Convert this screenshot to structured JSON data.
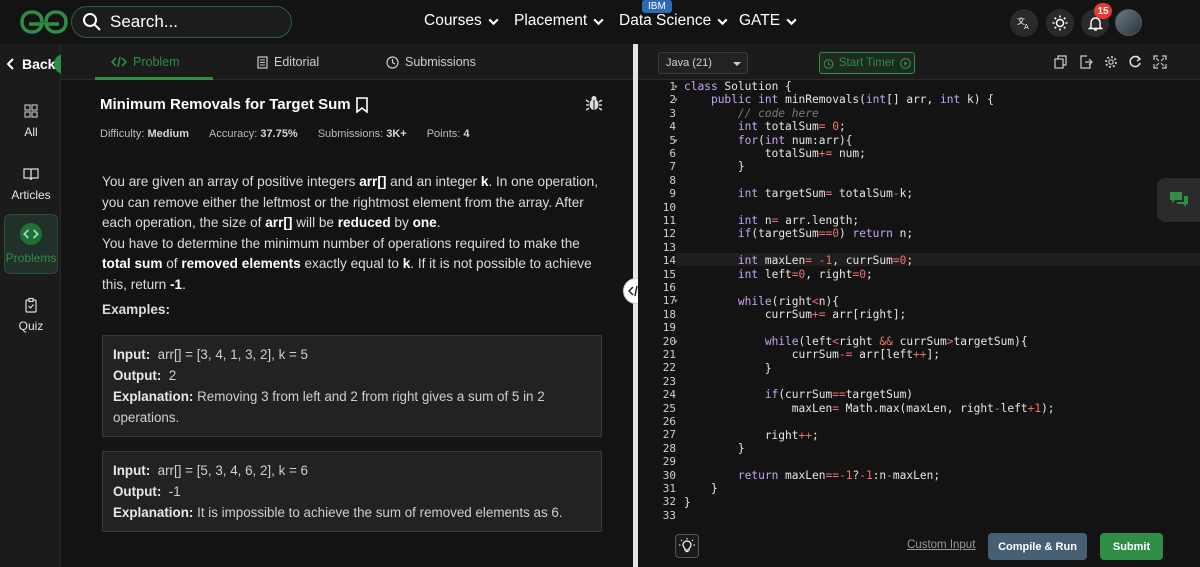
{
  "topnav": {
    "search_placeholder": "Search...",
    "courses": "Courses",
    "placement": "Placement",
    "data_science": "Data Science",
    "data_science_badge": "IBM",
    "gate": "GATE",
    "notification_count": "15"
  },
  "sidebar": {
    "back": "Back",
    "items": [
      {
        "label": "All",
        "icon": "grid-icon"
      },
      {
        "label": "Articles",
        "icon": "book-icon"
      },
      {
        "label": "Problems",
        "icon": "code-icon"
      },
      {
        "label": "Quiz",
        "icon": "clipboard-icon"
      }
    ]
  },
  "tabs": {
    "problem": "Problem",
    "editorial": "Editorial",
    "submissions": "Submissions"
  },
  "problem": {
    "title": "Minimum Removals for Target Sum",
    "difficulty_label": "Difficulty:",
    "difficulty": "Medium",
    "accuracy_label": "Accuracy:",
    "accuracy": "37.75%",
    "submissions_label": "Submissions:",
    "submissions": "3K+",
    "points_label": "Points:",
    "points": "4",
    "d1": "You are given an array of positive integers ",
    "d1b": "arr[]",
    "d2": " and an integer ",
    "d2b": "k",
    "d3": ". In one operation, you can remove either the leftmost or the rightmost element from the array. After each operation, the size of ",
    "d3b": "arr[]",
    "d4": " will be ",
    "d4b": "reduced",
    "d5": " by ",
    "d5b": "one",
    "d6": ".",
    "d7": "You have to determine the minimum number of operations required to make the ",
    "d7b": "total sum",
    "d8": " of ",
    "d8b": "removed elements",
    "d9": " exactly equal to ",
    "d9b": "k",
    "d10": ". If it is not possible to achieve this, return ",
    "d10b": "-1",
    "d11": ".",
    "examples_heading": "Examples:",
    "examples": [
      {
        "input_label": "Input:",
        "input": "arr[] = [3, 4, 1, 3, 2], k = 5",
        "output_label": "Output:",
        "output": "2",
        "explanation_label": "Explanation:",
        "explanation": "Removing 3 from left and 2 from right gives a sum of 5 in 2 operations."
      },
      {
        "input_label": "Input:",
        "input": "arr[] = [5, 3, 4, 6, 2], k = 6",
        "output_label": "Output:",
        "output": "-1",
        "explanation_label": "Explanation:",
        "explanation": "It is impossible to achieve the sum of removed elements as 6."
      }
    ]
  },
  "editor": {
    "language": "Java (21)",
    "start_timer": "Start Timer",
    "line_count": 33,
    "custom_input": "Custom Input",
    "compile_run": "Compile & Run",
    "submit": "Submit"
  },
  "colors": {
    "brand_green": "#2f8d46",
    "run_button": "#475f73",
    "notification_red": "#e53935"
  }
}
